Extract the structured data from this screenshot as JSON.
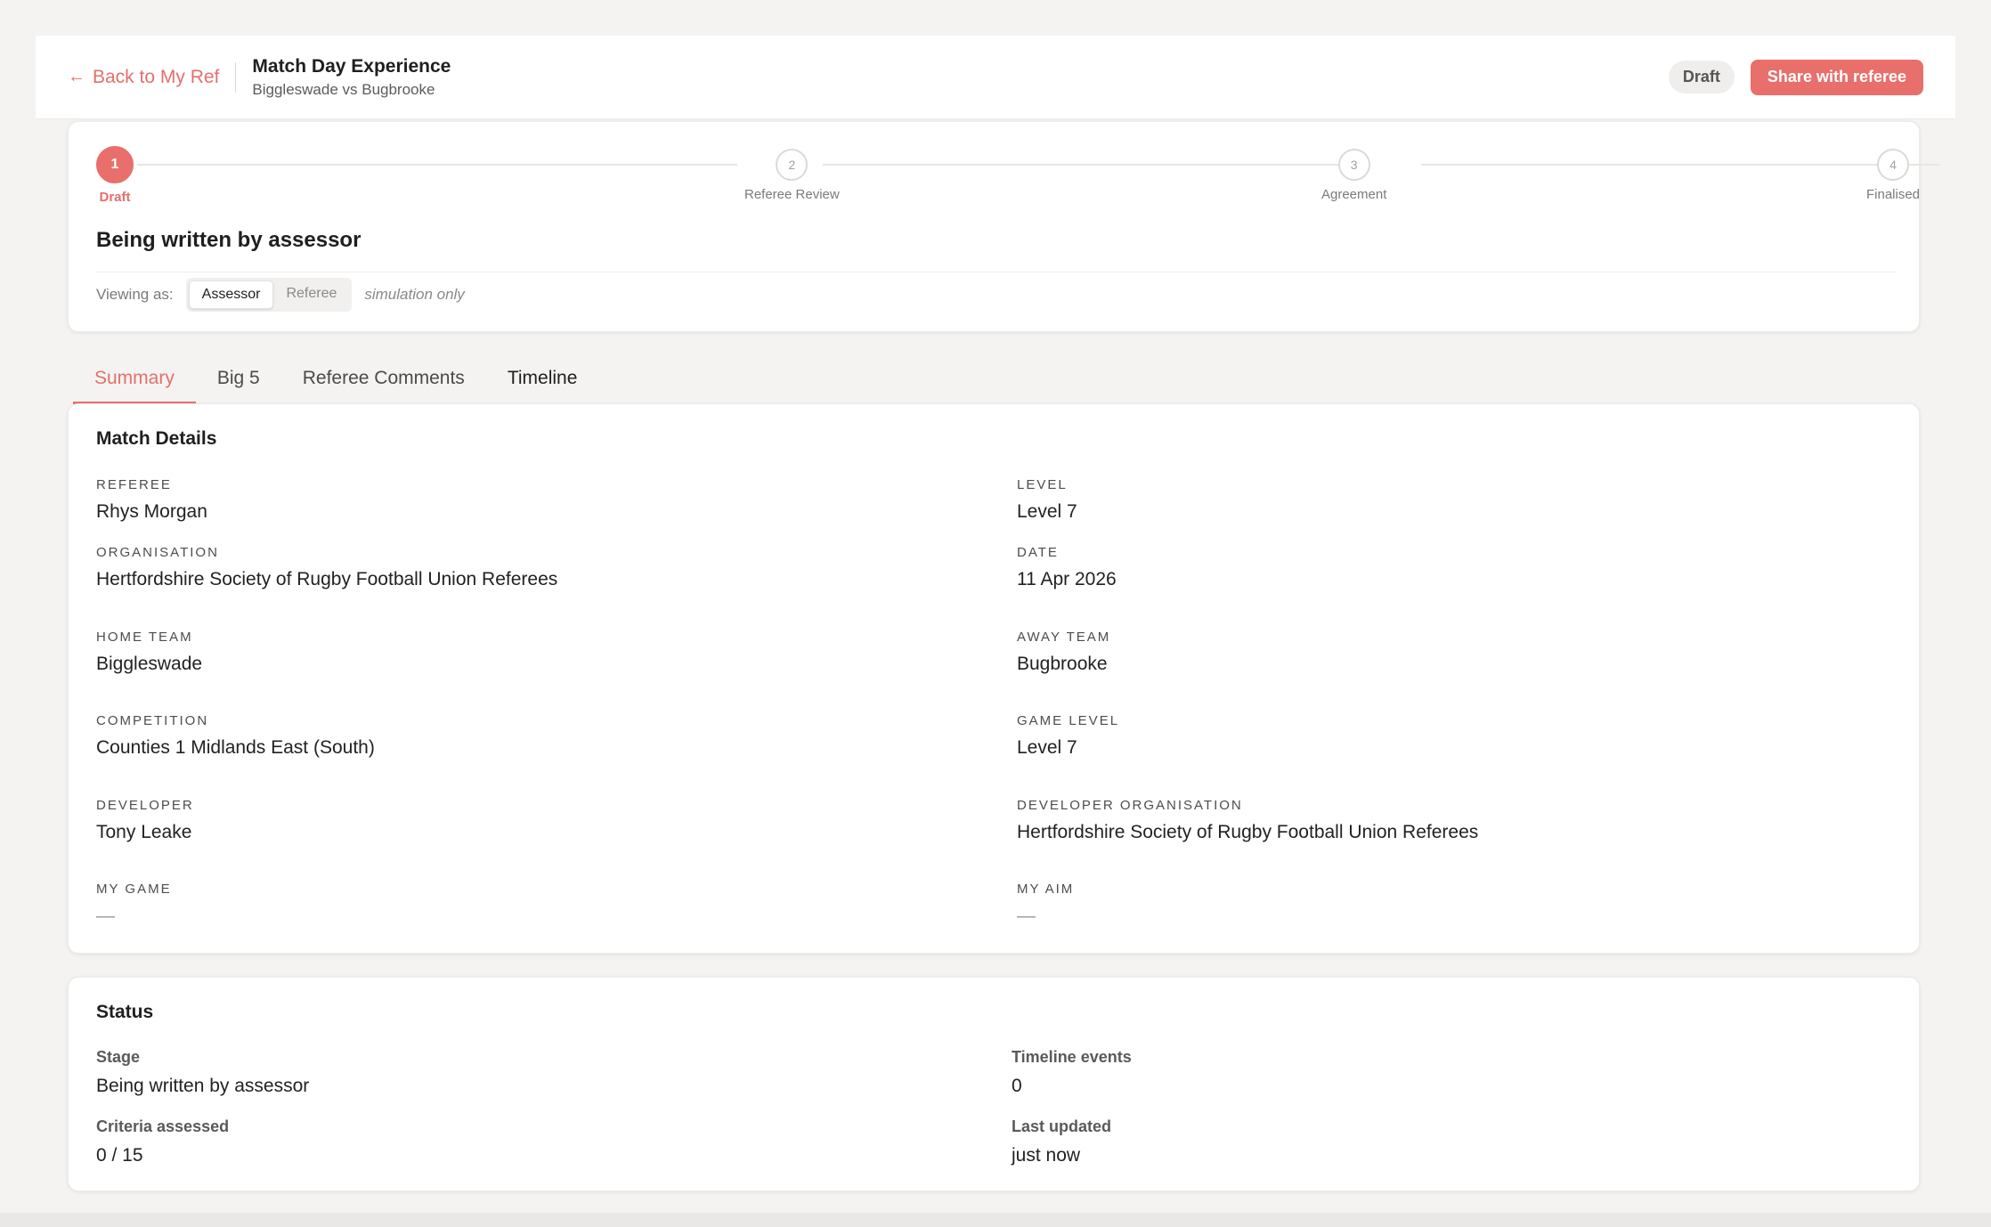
{
  "header": {
    "back_label": "Back to My Ref",
    "title": "Match Day Experience",
    "subtitle": "Biggleswade vs Bugbrooke",
    "status_badge": "Draft",
    "share_label": "Share with referee"
  },
  "progress": {
    "steps": [
      {
        "number": "1",
        "label": "Draft"
      },
      {
        "number": "2",
        "label": "Referee Review"
      },
      {
        "number": "3",
        "label": "Agreement"
      },
      {
        "number": "4",
        "label": "Finalised"
      }
    ],
    "stage_title": "Being written by assessor",
    "viewing_label": "Viewing as:",
    "view_options": [
      "Assessor",
      "Referee"
    ],
    "selected_view": "Assessor",
    "simulation_note": "simulation only"
  },
  "tabs": [
    "Summary",
    "Big 5",
    "Referee Comments",
    "Timeline"
  ],
  "active_tab": "Summary",
  "match_details": {
    "title": "Match Details",
    "fields": {
      "referee": {
        "label": "Referee",
        "value": "Rhys Morgan"
      },
      "level": {
        "label": "Level",
        "value": "Level 7"
      },
      "organisation": {
        "label": "Organisation",
        "value": "Hertfordshire Society of Rugby Football Union Referees"
      },
      "date": {
        "label": "Date",
        "value": "11 Apr 2026"
      },
      "home_team": {
        "label": "Home Team",
        "value": "Biggleswade"
      },
      "away_team": {
        "label": "Away Team",
        "value": "Bugbrooke"
      },
      "competition": {
        "label": "Competition",
        "value": "Counties 1 Midlands East (South)"
      },
      "game_level": {
        "label": "Game Level",
        "value": "Level 7"
      },
      "developer": {
        "label": "Developer",
        "value": "Tony Leake"
      },
      "developer_org": {
        "label": "Developer Organisation",
        "value": "Hertfordshire Society of Rugby Football Union Referees"
      },
      "my_game": {
        "label": "My Game",
        "value": "—"
      },
      "my_aim": {
        "label": "My Aim",
        "value": "—"
      }
    }
  },
  "status": {
    "title": "Status",
    "stage": {
      "label": "Stage",
      "value": "Being written by assessor"
    },
    "timeline_events": {
      "label": "Timeline events",
      "value": "0"
    },
    "criteria": {
      "label": "Criteria assessed",
      "value": "0 / 15"
    },
    "updated": {
      "label": "Last updated",
      "value": "just now"
    }
  },
  "colors": {
    "accent": "#e86f6b",
    "background": "#f4f3f1",
    "card": "#ffffff"
  }
}
